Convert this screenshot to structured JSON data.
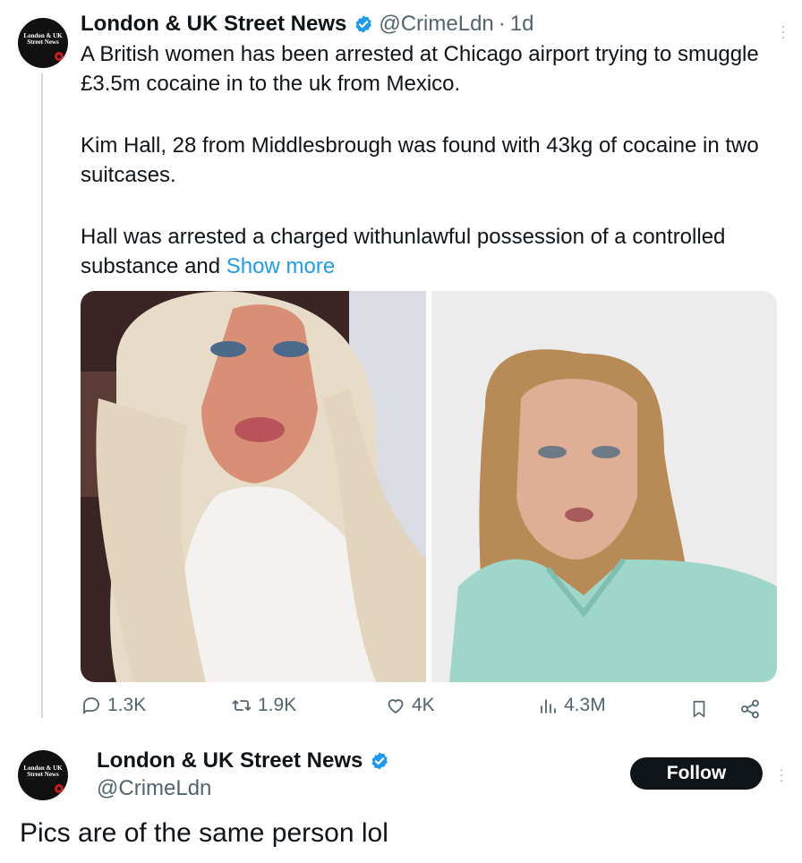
{
  "tweet": {
    "author_name": "London & UK Street News",
    "handle": "@CrimeLdn",
    "separator": "·",
    "time": "1d",
    "avatar_logo_text": "London & UK Street News",
    "paragraphs": [
      "A British women has been arrested at Chicago airport trying to smuggle £3.5m cocaine in to the uk from Mexico.",
      "Kim Hall, 28 from Middlesbrough was found with 43kg of cocaine in two suitcases.",
      "Hall was arrested a charged withunlawful possession of a controlled substance and"
    ],
    "show_more": "Show more",
    "photos": [
      "selfie-photo",
      "mugshot-photo"
    ],
    "stats": {
      "replies": "1.3K",
      "reposts": "1.9K",
      "likes": "4K",
      "views": "4.3M"
    }
  },
  "author_card": {
    "name": "London & UK Street News",
    "handle": "@CrimeLdn",
    "follow_label": "Follow"
  },
  "reply": {
    "text": "Pics are of the same person lol"
  },
  "colors": {
    "accent": "#1d9bf0",
    "text": "#0f1419",
    "secondary_text": "#536471",
    "thread_line": "#cfd9de"
  },
  "icons": [
    "verified-badge-icon",
    "more-options-icon",
    "reply-icon",
    "repost-icon",
    "like-icon",
    "views-icon",
    "bookmark-icon",
    "share-icon"
  ]
}
